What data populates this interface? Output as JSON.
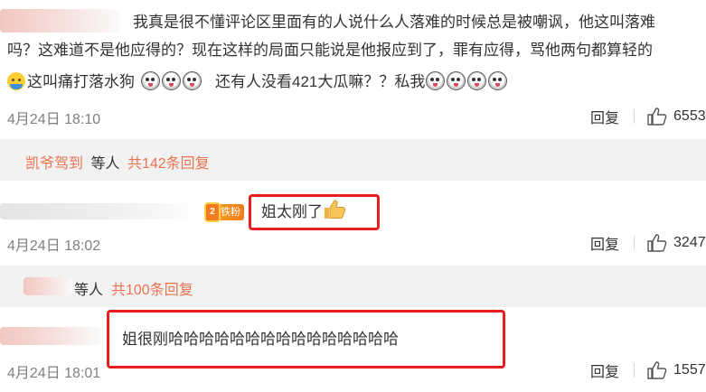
{
  "comments": [
    {
      "text_lines": [
        "我真是很不懂评论区里面有的人说什么人落难的时候总是被嘲讽，他这叫落难",
        "吗？这难道不是他应得的？现在这样的局面只能说是他报应到了，罪有应得，骂他两句都算轻的",
        "这叫痛打落水狗",
        "还有人没看421大瓜嘛？？私我"
      ],
      "time": "4月24日 18:10",
      "reply_label": "回复",
      "likes": "6553"
    },
    {
      "badge": "铁粉",
      "badge_level": "2",
      "text": "姐太刚了",
      "time": "4月24日 18:02",
      "reply_label": "回复",
      "likes": "3247"
    },
    {
      "text": "姐很刚哈哈哈哈哈哈哈哈哈哈哈哈哈哈哈",
      "time": "4月24日 18:01",
      "reply_label": "回复",
      "likes": "1557"
    }
  ],
  "reply_threads": [
    {
      "name": "凯爷驾到",
      "etc": "等人",
      "count": "共142条回复"
    },
    {
      "name": "",
      "etc": "等人",
      "count": "共100条回复"
    }
  ],
  "colors": {
    "highlight": "#e61e1e",
    "link": "#eb7350",
    "strip": "#f2f2f2"
  },
  "icons": [
    "sunglasses-face-emoji",
    "thumbs-up-emoji",
    "like-icon",
    "fan-badge-icon"
  ]
}
